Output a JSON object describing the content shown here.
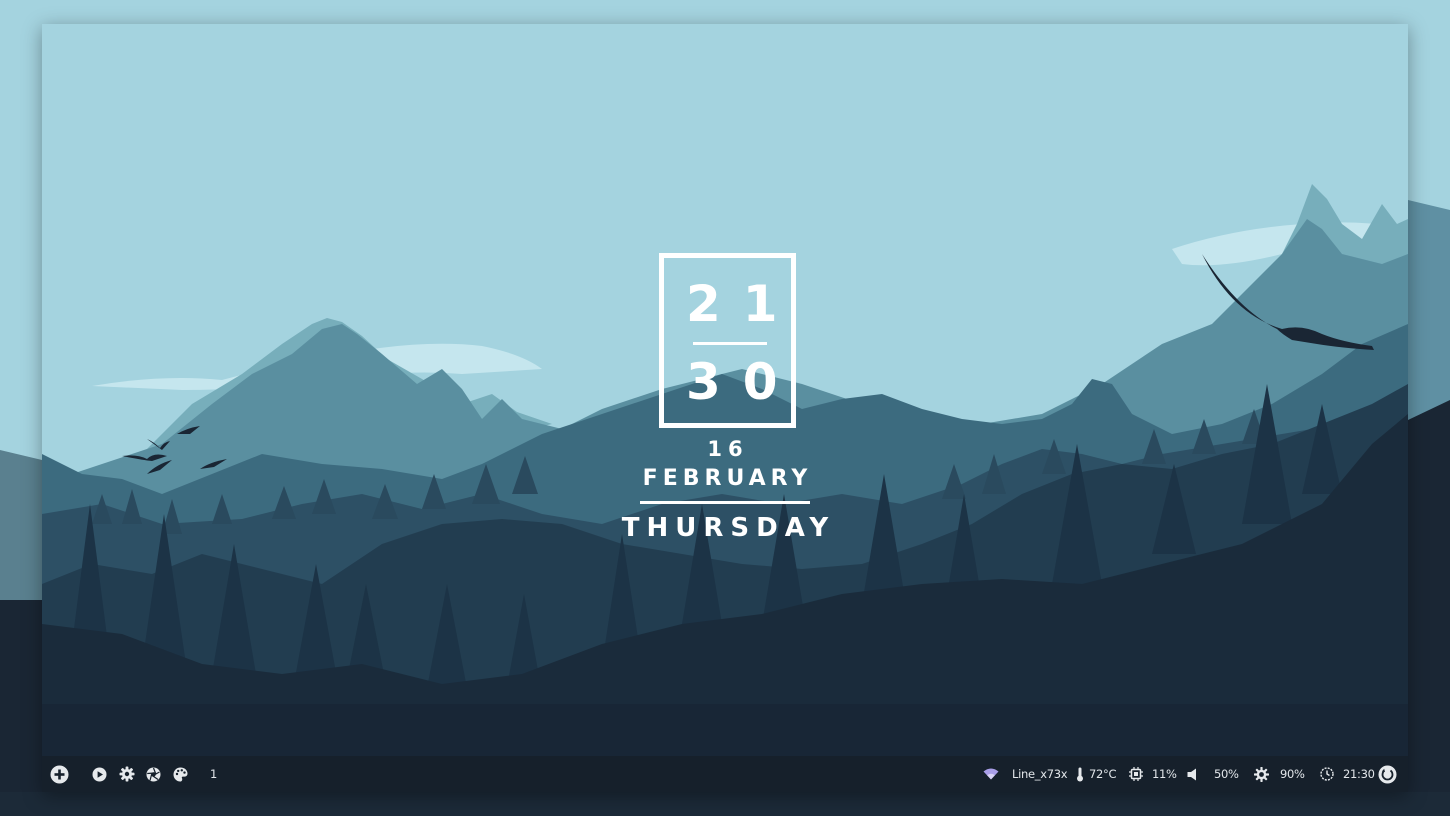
{
  "clock": {
    "hours": "21",
    "minutes": "30",
    "day": "16",
    "month": "FEBRUARY",
    "weekday": "THURSDAY"
  },
  "taskbar": {
    "left": {
      "launcher_icon": "plus-circle-icon",
      "apps": [
        {
          "icon": "play-icon"
        },
        {
          "icon": "gear-icon"
        },
        {
          "icon": "aperture-icon"
        },
        {
          "icon": "palette-icon"
        }
      ],
      "workspace": "1"
    },
    "right": {
      "wifi_label": "Line_x73x",
      "temperature_label": "72°C",
      "cpu_label": "11%",
      "volume_label": "50%",
      "brightness_label": "90%",
      "time_label": "21:30",
      "power_icon": "power-icon"
    }
  },
  "colors": {
    "sky": "#a4d3df",
    "taskbar": "#16202b",
    "clock_text": "#ffffff",
    "wifi_accent": "#a99ee8"
  }
}
